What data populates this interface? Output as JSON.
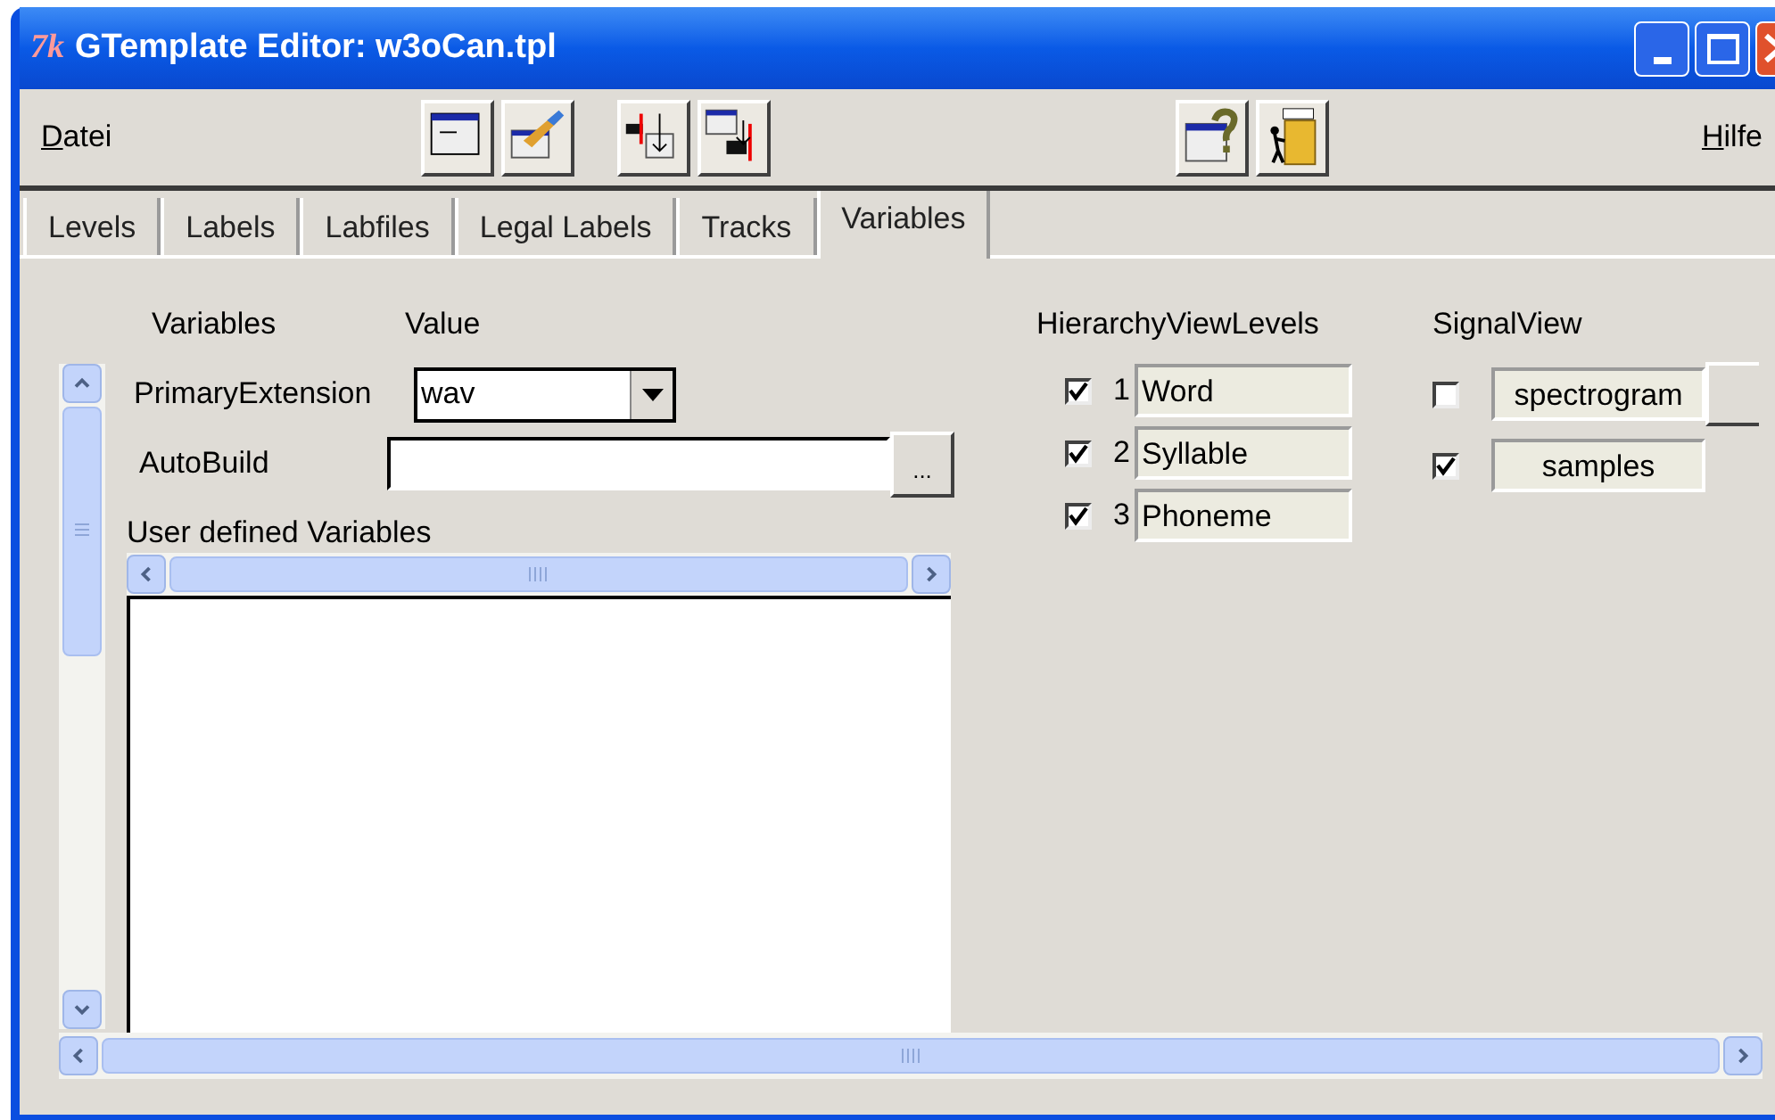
{
  "window": {
    "logo": "7k",
    "title": "GTemplate Editor: w3oCan.tpl"
  },
  "menu": [
    {
      "label": "Datei"
    },
    {
      "label": "Hilfe"
    }
  ],
  "tabs": [
    {
      "label": "Levels",
      "selected": false
    },
    {
      "label": "Labels",
      "selected": false
    },
    {
      "label": "Labfiles",
      "selected": false
    },
    {
      "label": "Legal Labels",
      "selected": false
    },
    {
      "label": "Tracks",
      "selected": false
    },
    {
      "label": "Variables",
      "selected": true
    }
  ],
  "variables": {
    "headers": [
      "Variables",
      "Value"
    ],
    "primary_extension": {
      "label": "PrimaryExtension",
      "value": "wav"
    },
    "auto_build": {
      "label": "AutoBuild",
      "button": "..."
    },
    "user_defined_label": "User defined Variables"
  },
  "hierarchy": {
    "title": "HierarchyViewLevels",
    "levels": [
      {
        "number": "1",
        "name": "Word",
        "checked": true
      },
      {
        "number": "2",
        "name": "Syllable",
        "checked": true
      },
      {
        "number": "3",
        "name": "Phoneme",
        "checked": true
      }
    ]
  },
  "signal_view": {
    "title": "SignalView",
    "items": [
      {
        "name": "spectrogram",
        "checked": false
      },
      {
        "name": "samples",
        "checked": true
      }
    ]
  }
}
